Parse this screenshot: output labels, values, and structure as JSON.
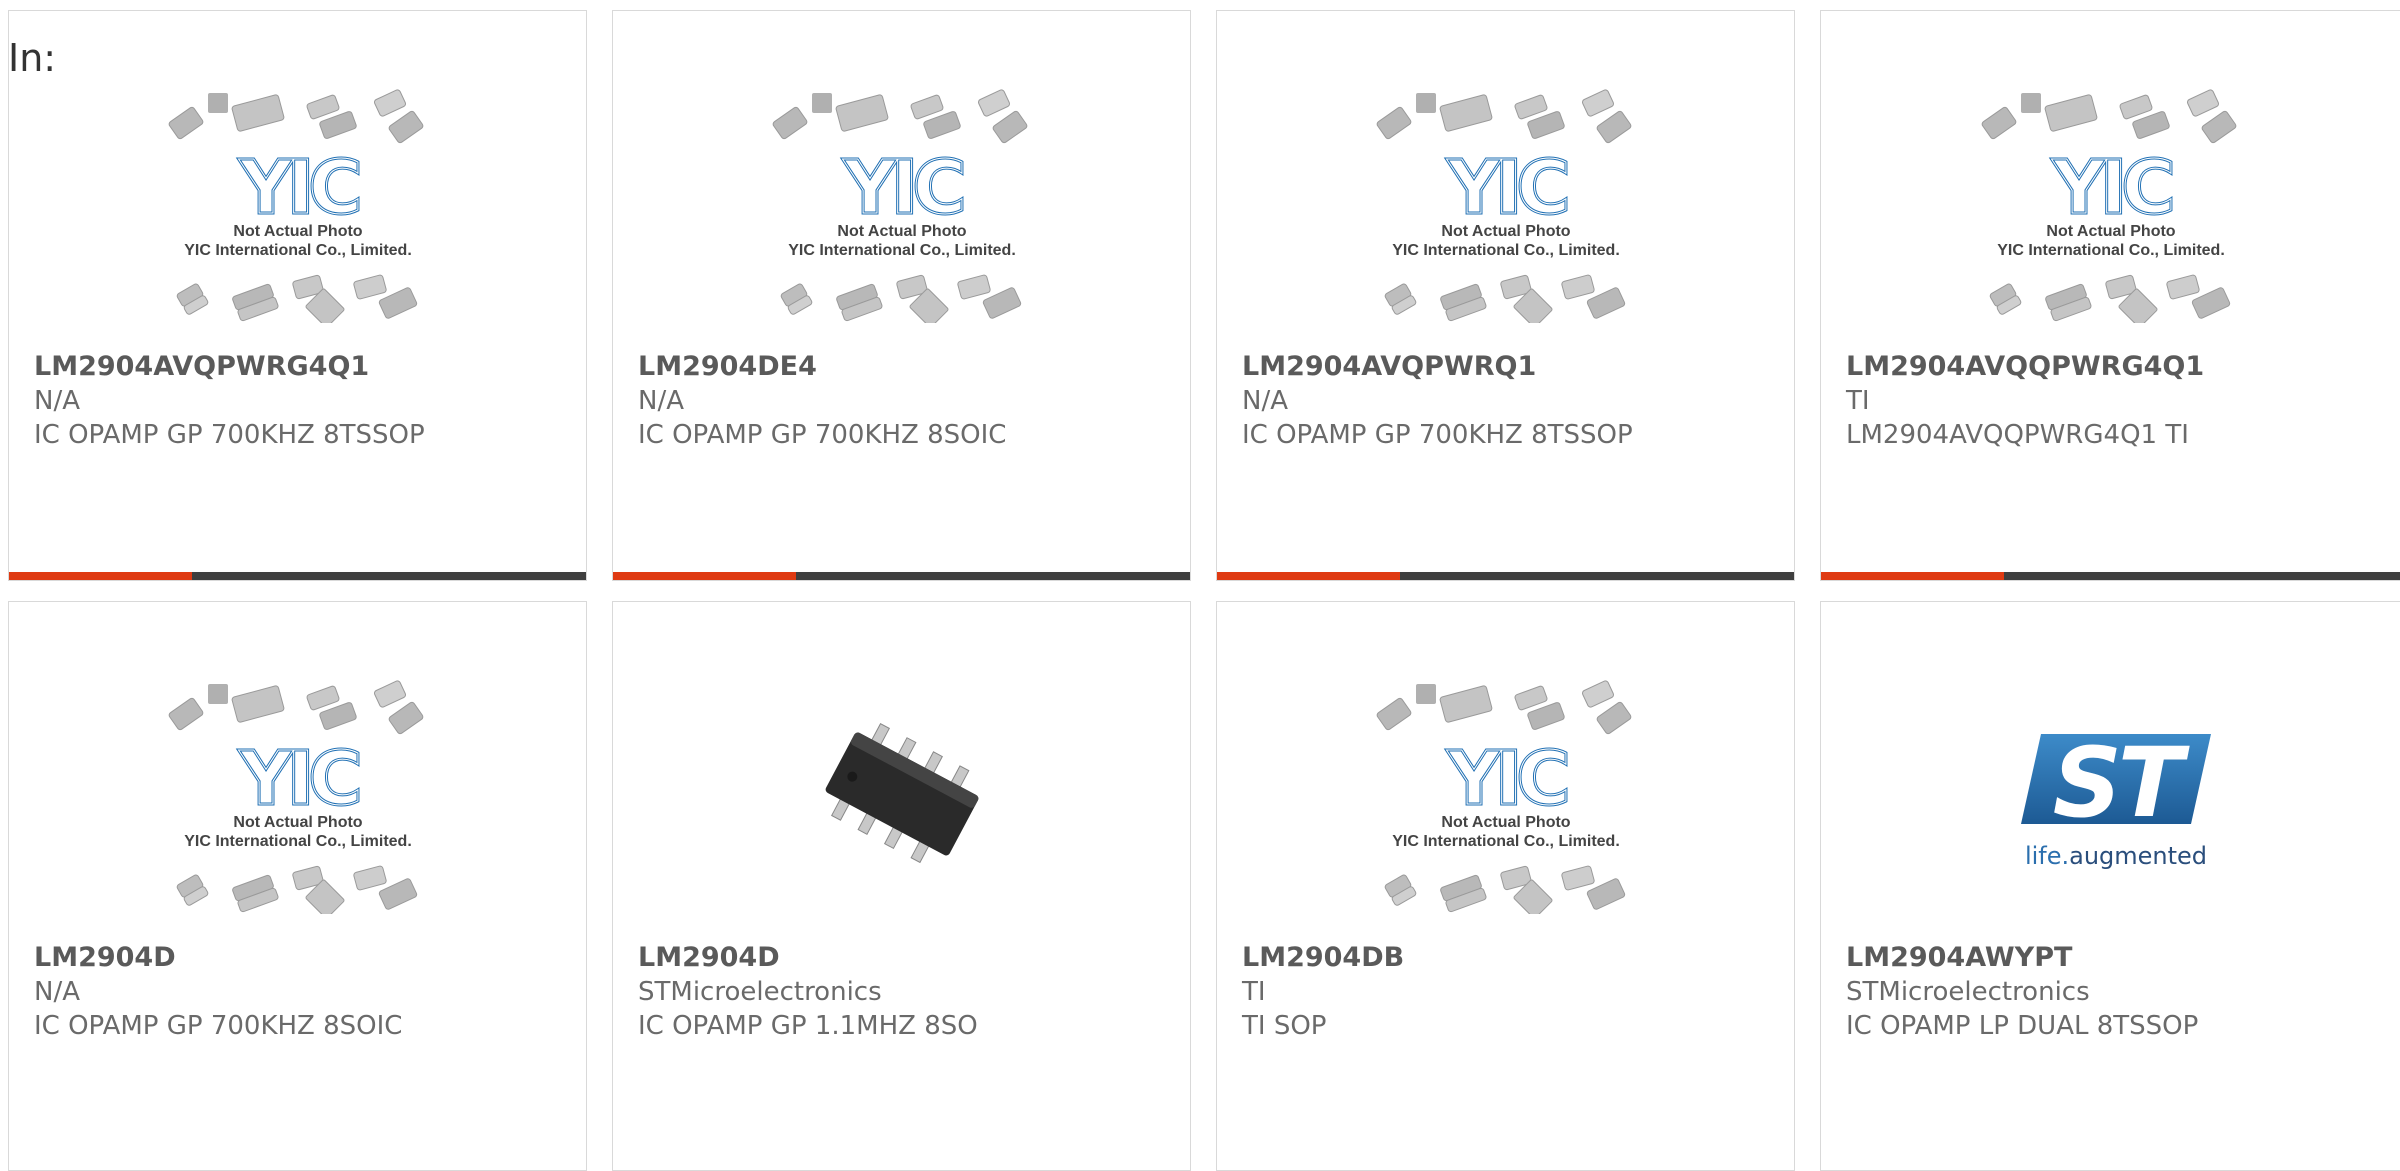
{
  "filter_label": "In:",
  "placeholder": {
    "brand": "YIC",
    "caption_line1": "Not Actual Photo",
    "caption_line2": "YIC International Co., Limited."
  },
  "st_logo": {
    "mark": "ST",
    "tagline_prefix": "life.",
    "tagline_suffix": "augmented"
  },
  "colors": {
    "accent": "#df3a12",
    "bar": "#3f3f3f",
    "yic_blue": "#1f6fb3",
    "st_blue": "#2b6fae"
  },
  "products": [
    {
      "part": "LM2904AVQPWRG4Q1",
      "manufacturer": "N/A",
      "description": "IC OPAMP GP 700KHZ 8TSSOP",
      "image": "placeholder"
    },
    {
      "part": "LM2904DE4",
      "manufacturer": "N/A",
      "description": "IC OPAMP GP 700KHZ 8SOIC",
      "image": "placeholder"
    },
    {
      "part": "LM2904AVQPWRQ1",
      "manufacturer": "N/A",
      "description": "IC OPAMP GP 700KHZ 8TSSOP",
      "image": "placeholder"
    },
    {
      "part": "LM2904AVQQPWRG4Q1",
      "manufacturer": "TI",
      "description": "LM2904AVQQPWRG4Q1 TI",
      "image": "placeholder"
    },
    {
      "part": "LM2904D",
      "manufacturer": "N/A",
      "description": "IC OPAMP GP 700KHZ 8SOIC",
      "image": "placeholder"
    },
    {
      "part": "LM2904D",
      "manufacturer": "STMicroelectronics",
      "description": "IC OPAMP GP 1.1MHZ 8SO",
      "image": "chip-photo"
    },
    {
      "part": "LM2904DB",
      "manufacturer": "TI",
      "description": "TI SOP",
      "image": "placeholder"
    },
    {
      "part": "LM2904AWYPT",
      "manufacturer": "STMicroelectronics",
      "description": "IC OPAMP LP DUAL 8TSSOP",
      "image": "st-logo"
    }
  ]
}
